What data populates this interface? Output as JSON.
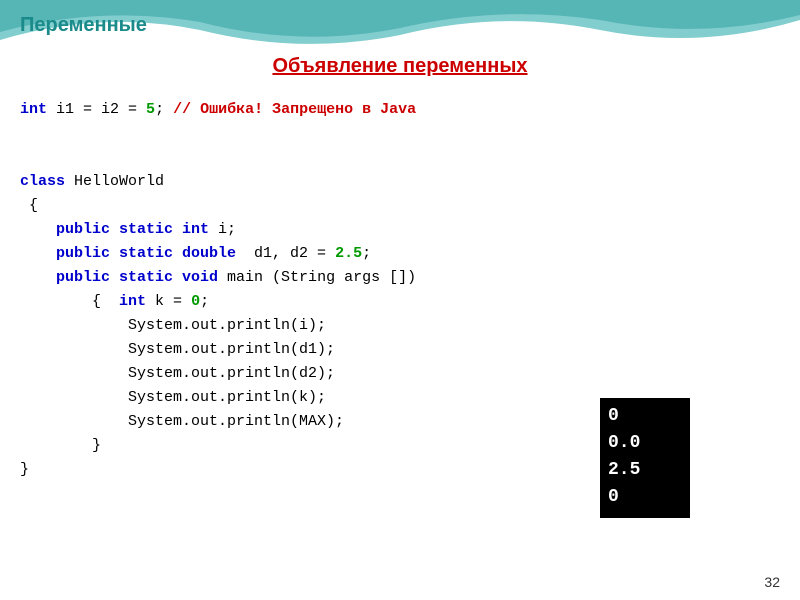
{
  "slide": {
    "title": "Переменные",
    "page_number": "32",
    "section_heading": "Объявление  переменных"
  },
  "code": {
    "line1": "int i1 = i2 = 5; // Ошибка! Запрещено в Java",
    "blank1": "",
    "blank2": "",
    "class_decl": "class HelloWorld",
    "brace_open": " {",
    "field1_prefix": "    public static int i;",
    "field2_prefix": "    public static double  d1, d2 = 2.5;",
    "field3_prefix": "    public static void main (String args [])",
    "method_open": "        {  int k = 0;",
    "stmt1": "            System.out.println(i);",
    "stmt2": "            System.out.println(d1);",
    "stmt3": "            System.out.println(d2);",
    "stmt4": "            System.out.println(k);",
    "stmt5": "            System.out.println(MAX);",
    "method_close": "        }",
    "class_close": "}"
  },
  "output": {
    "lines": [
      "0",
      "0.0",
      "2.5",
      "0"
    ]
  }
}
